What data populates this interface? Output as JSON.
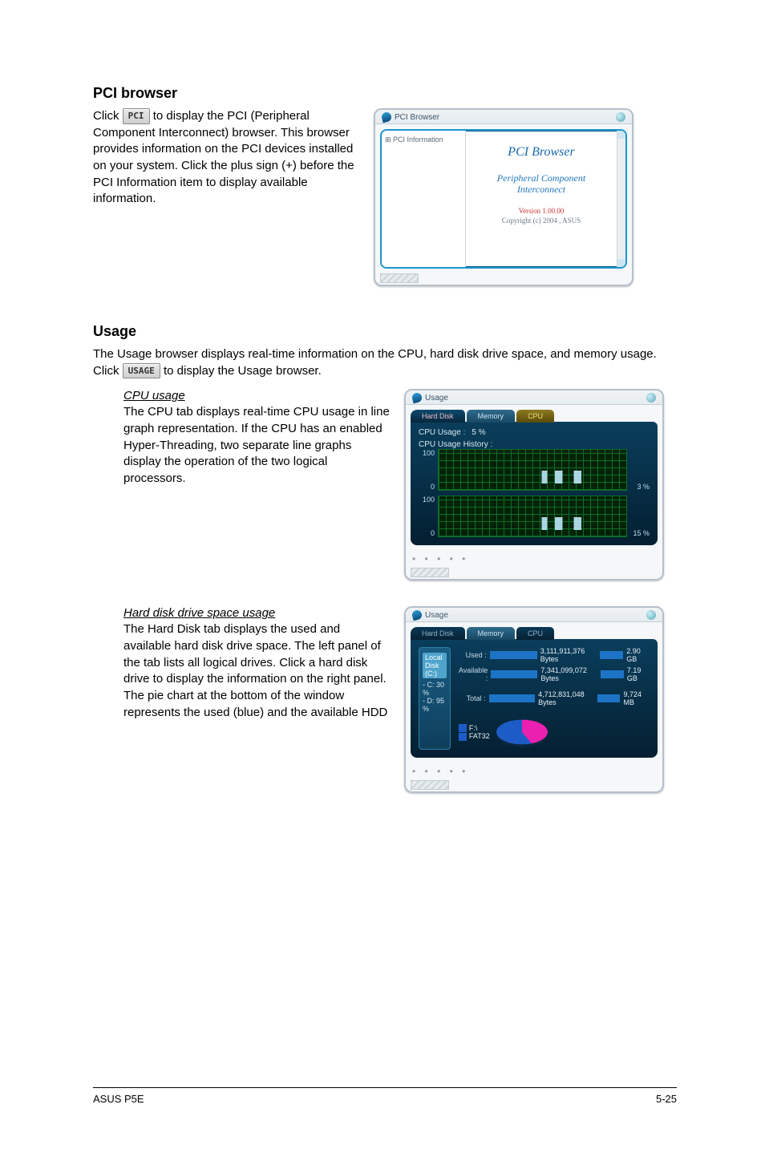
{
  "pci": {
    "heading": "PCI browser",
    "btn_label": "PCI",
    "para_pre": "Click ",
    "para_post": " to display the PCI (Peripheral Component Interconnect) browser. This browser provides information on the PCI devices installed on your system. Click the plus sign (+) before the PCI Information item to display available information.",
    "window": {
      "title": "PCI Browser",
      "tree_item": "⊞ PCI Information",
      "main_title": "PCI Browser",
      "sub1": "Peripheral Component",
      "sub2": "Interconnect",
      "version": "Version 1.00.00",
      "copyright": "Copyright (c) 2004 , ASUS"
    }
  },
  "usage": {
    "heading": "Usage",
    "intro_pre": "The Usage browser displays real-time information on the CPU, hard disk drive space, and memory usage. Click ",
    "btn_label": "USAGE",
    "intro_post": " to display the Usage browser.",
    "cpu": {
      "sub": "CPU usage",
      "para": "The CPU tab displays real-time CPU usage in line graph representation. If the CPU has an enabled Hyper-Threading, two separate line graphs display the operation of the two logical processors.",
      "window_title": "Usage",
      "tab_hd": "Hard Disk",
      "tab_mem": "Memory",
      "tab_cpu": "CPU",
      "label_usage": "CPU Usage :",
      "val_usage": "5 %",
      "label_hist": "CPU Usage History :",
      "axis_top": "100",
      "axis_bot": "0",
      "pct1": "3 %",
      "pct2": "15 %"
    },
    "hd": {
      "sub": "Hard disk drive space usage",
      "para": "The Hard Disk tab displays the used and available hard disk drive space. The left panel of the tab lists all logical drives. Click a hard disk drive to display the information on the right panel. The pie chart at the bottom of the window represents the used (blue) and the available HDD",
      "window_title": "Usage",
      "tab_hd": "Hard Disk",
      "tab_mem": "Memory",
      "tab_cpu": "CPU",
      "drive_hdr": "Local Disk (C:)",
      "drive_c": "- C: 30 %",
      "drive_d": "- D: 95 %",
      "row_used": "Used :",
      "row_avail": "Available :",
      "row_total": "Total :",
      "used_val": "3,111,911,376 Bytes",
      "used_gb": "2.90 GB",
      "avail_val": "7,341,099,072 Bytes",
      "avail_gb": "7.19 GB",
      "total_val": "4,712,831,048 Bytes",
      "total_gb": "9,724 MB",
      "legend_f": "F:\\",
      "legend_fat": "FAT32"
    }
  },
  "footer": {
    "left": "ASUS P5E",
    "right": "5-25"
  }
}
